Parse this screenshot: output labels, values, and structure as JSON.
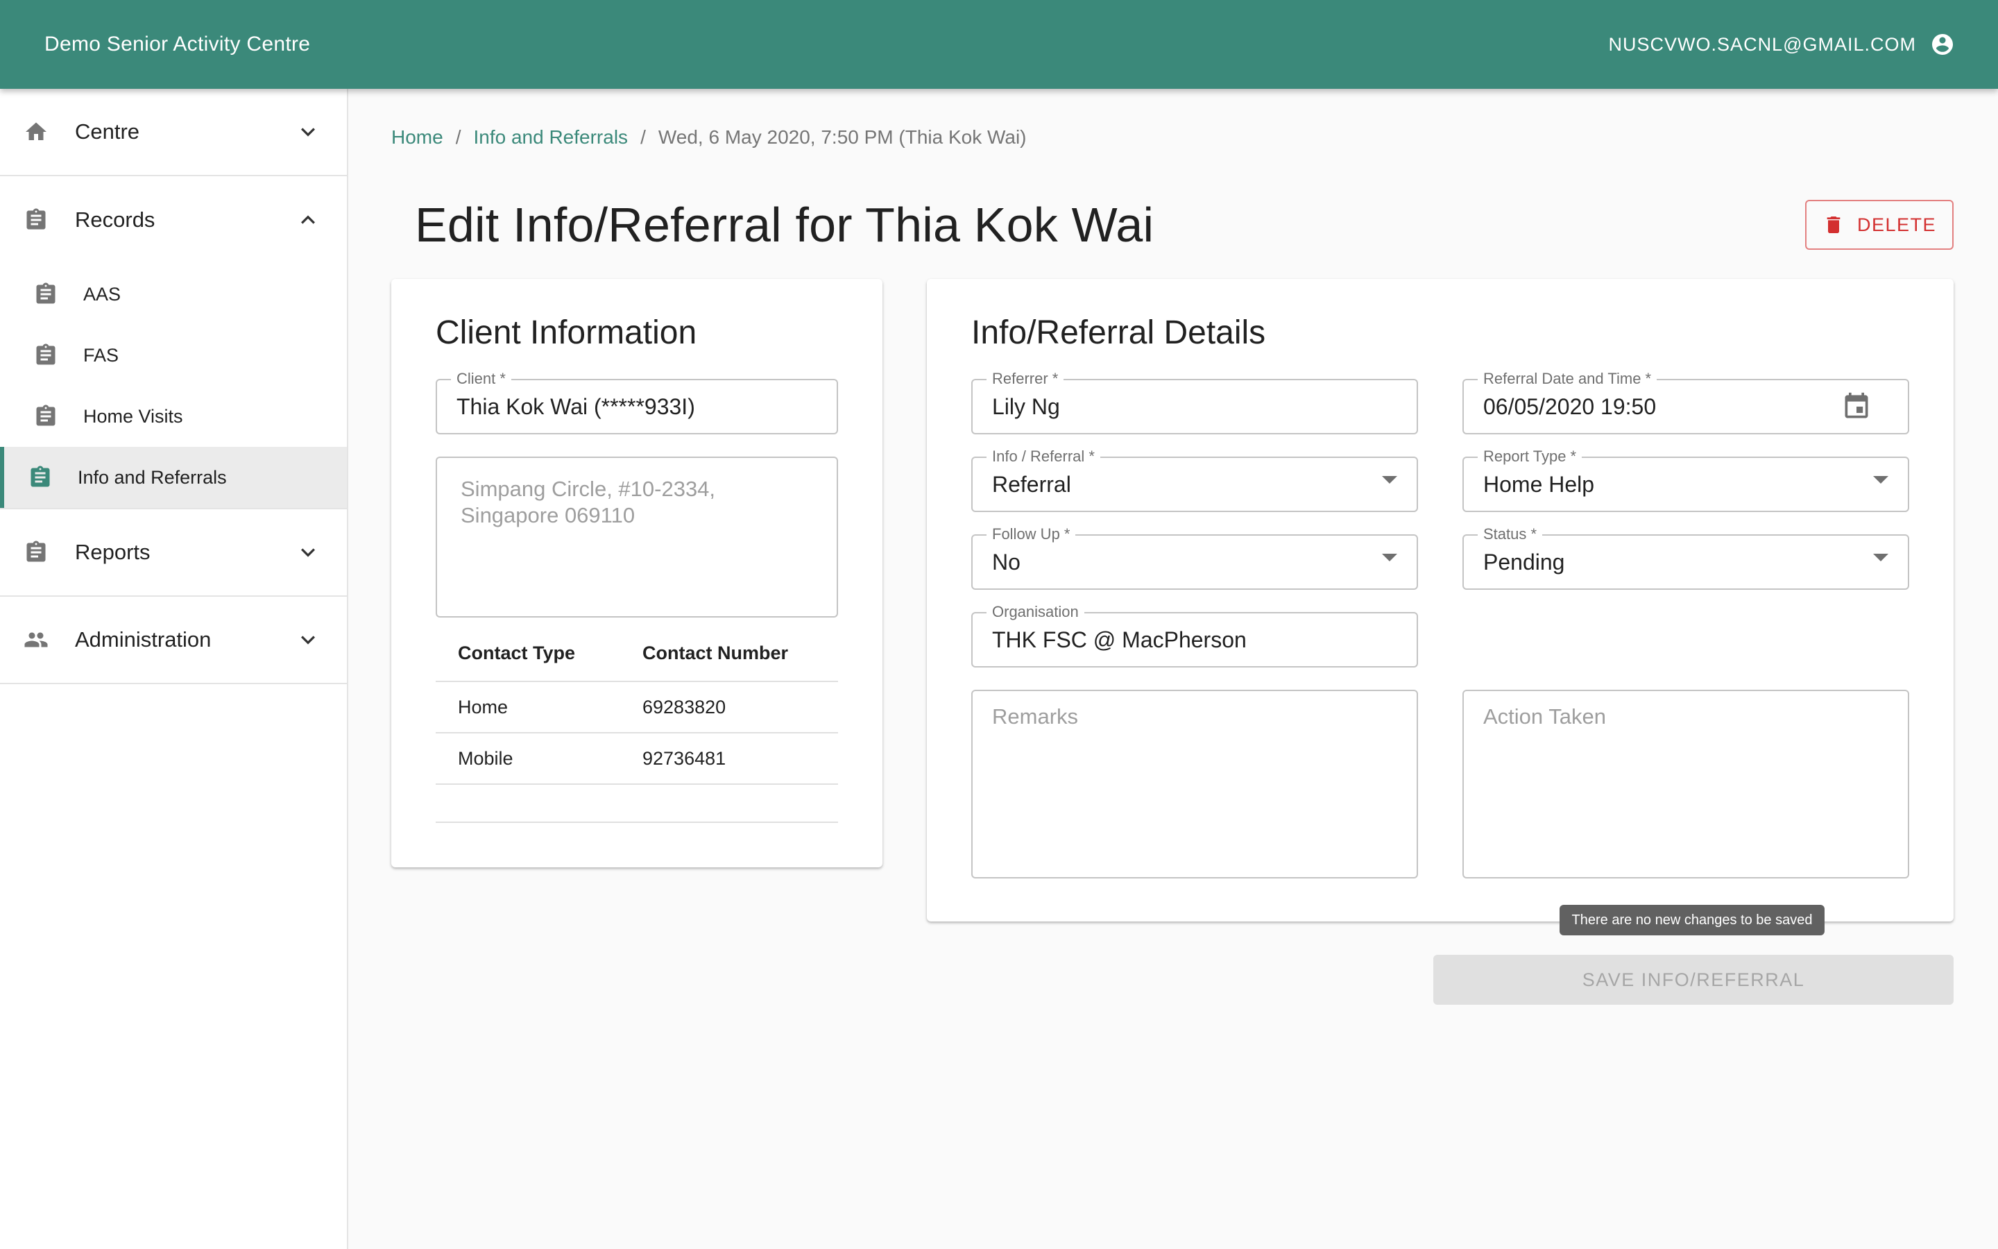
{
  "app": {
    "title": "Demo Senior Activity Centre",
    "user_email": "NUSCVWO.SACNL@GMAIL.COM",
    "brand_color": "#3b897a"
  },
  "sidebar": {
    "groups": [
      {
        "label": "Centre",
        "icon": "home-icon",
        "expanded": false
      },
      {
        "label": "Records",
        "icon": "clipboard-icon",
        "expanded": true
      },
      {
        "label": "Reports",
        "icon": "clipboard-icon",
        "expanded": false
      },
      {
        "label": "Administration",
        "icon": "people-icon",
        "expanded": false
      }
    ],
    "records_items": [
      {
        "label": "AAS"
      },
      {
        "label": "FAS"
      },
      {
        "label": "Home Visits"
      },
      {
        "label": "Info and Referrals",
        "active": true
      }
    ]
  },
  "breadcrumb": {
    "home": "Home",
    "section": "Info and Referrals",
    "current": "Wed, 6 May 2020, 7:50 PM (Thia Kok Wai)",
    "separator": "/"
  },
  "page": {
    "title": "Edit Info/Referral for Thia Kok Wai",
    "delete_label": "DELETE"
  },
  "client_card": {
    "title": "Client Information",
    "client_label": "Client *",
    "client_value": "Thia Kok Wai (*****933I)",
    "address_placeholder": "Simpang Circle, #10-2334,\nSingapore 069110",
    "contacts": {
      "headers": [
        "Contact Type",
        "Contact Number"
      ],
      "rows": [
        [
          "Home",
          "69283820"
        ],
        [
          "Mobile",
          "92736481"
        ]
      ]
    }
  },
  "details_card": {
    "title": "Info/Referral Details",
    "referrer": {
      "label": "Referrer *",
      "value": "Lily Ng"
    },
    "referral_datetime": {
      "label": "Referral Date and Time *",
      "value": "06/05/2020 19:50"
    },
    "info_referral": {
      "label": "Info / Referral *",
      "value": "Referral"
    },
    "report_type": {
      "label": "Report Type *",
      "value": "Home Help"
    },
    "follow_up": {
      "label": "Follow Up *",
      "value": "No"
    },
    "status": {
      "label": "Status *",
      "value": "Pending"
    },
    "organisation": {
      "label": "Organisation",
      "value": "THK FSC @ MacPherson"
    },
    "remarks_placeholder": "Remarks",
    "action_taken_placeholder": "Action Taken"
  },
  "save": {
    "tooltip": "There are no new changes to be saved",
    "label": "SAVE INFO/REFERRAL",
    "disabled": true
  }
}
